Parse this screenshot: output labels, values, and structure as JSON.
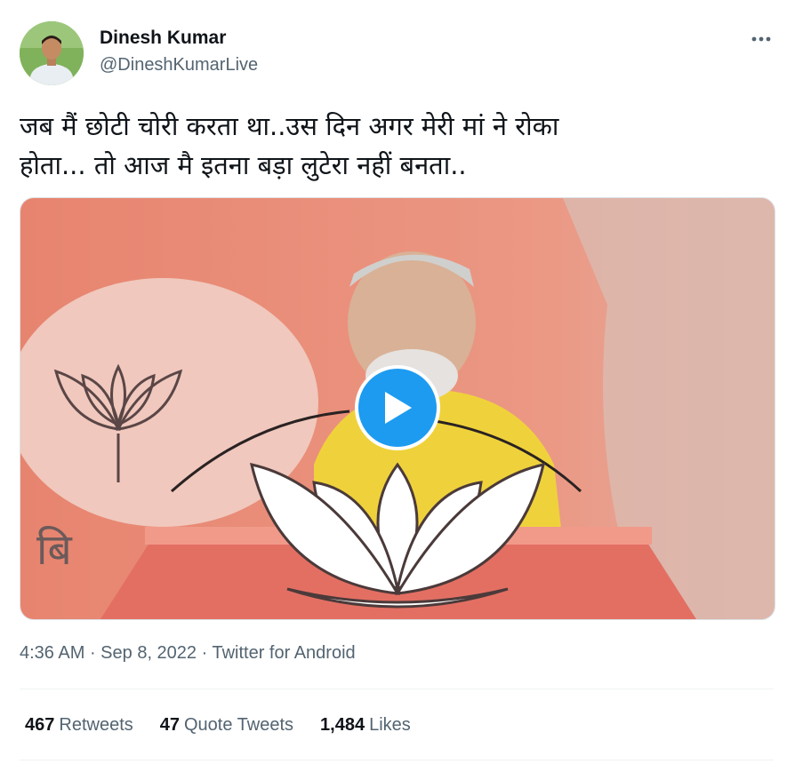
{
  "author": {
    "display_name": "Dinesh Kumar",
    "handle": "@DineshKumarLive"
  },
  "tweet": {
    "text": "जब मैं छोटी चोरी करता था..उस दिन अगर मेरी मां ने रोका\nहोता... तो आज मै इतना बड़ा लुटेरा नहीं बनता..",
    "video_overlay_text": "बि"
  },
  "meta": {
    "time": "4:36 AM",
    "separator": " · ",
    "date": "Sep 8, 2022",
    "source": "Twitter for Android"
  },
  "stats": {
    "retweets_count": "467",
    "retweets_label": "Retweets",
    "quote_tweets_count": "47",
    "quote_tweets_label": "Quote Tweets",
    "likes_count": "1,484",
    "likes_label": "Likes"
  },
  "icons": {
    "more": "more-horizontal-icon",
    "play": "play-icon"
  },
  "colors": {
    "accent": "#1d9bf0",
    "secondary_text": "#536471",
    "primary_text": "#0f1419",
    "video_bg": "#e88a74"
  }
}
